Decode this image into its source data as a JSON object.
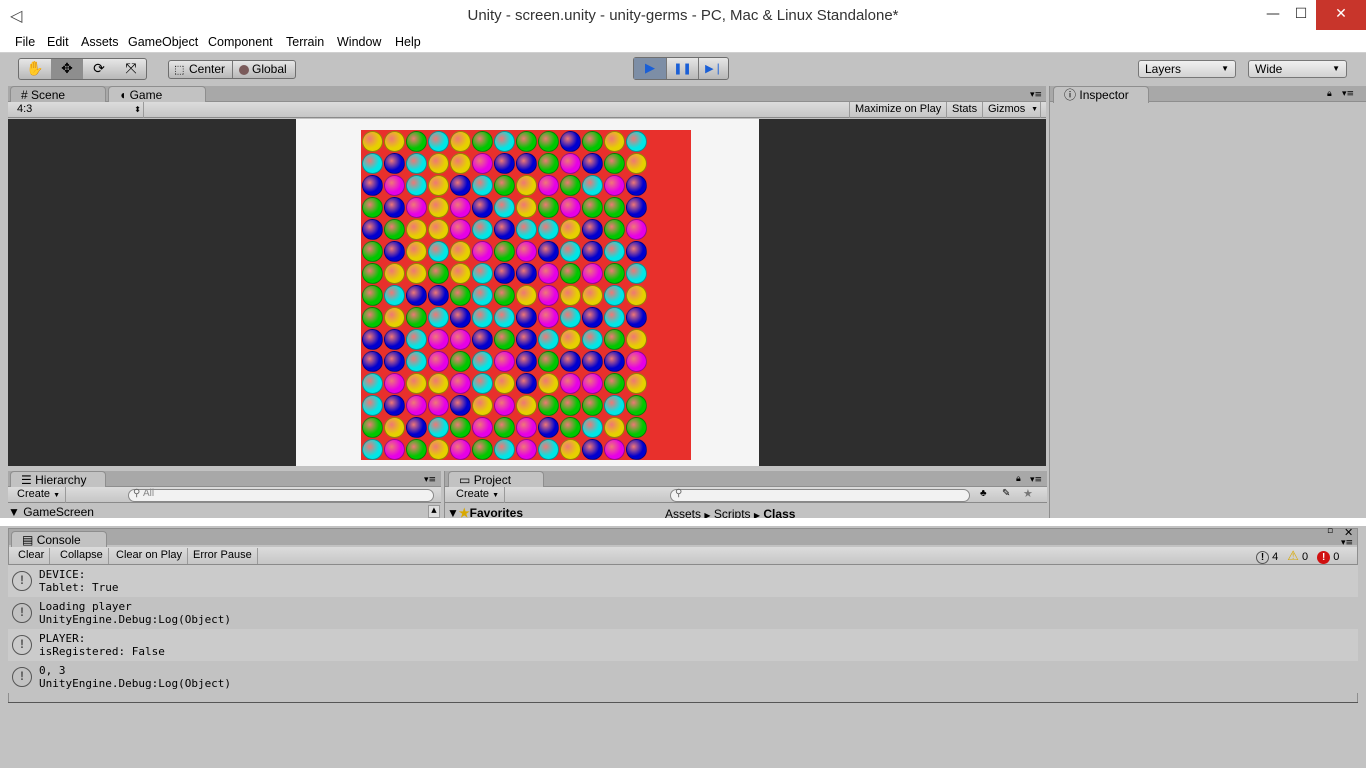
{
  "window": {
    "title": "Unity - screen.unity - unity-germs - PC, Mac & Linux Standalone*",
    "minimize": "—",
    "maximize": "☐",
    "close": "✕"
  },
  "menu": [
    "File",
    "Edit",
    "Assets",
    "GameObject",
    "Component",
    "Terrain",
    "Window",
    "Help"
  ],
  "toolbar": {
    "tools": [
      {
        "icon": "hand-icon",
        "glyph": "✋"
      },
      {
        "icon": "move-icon",
        "glyph": "✥"
      },
      {
        "icon": "rotate-icon",
        "glyph": "⟳"
      },
      {
        "icon": "scale-icon",
        "glyph": "⤧"
      }
    ],
    "pivot": "Center",
    "space": "Global",
    "play": "▶",
    "pause": "❚❚",
    "step": "▶❘",
    "layers": "Layers",
    "layout": "Wide"
  },
  "scene_tabs": {
    "scene": "Scene",
    "game": "Game"
  },
  "game_bar": {
    "aspect": "4:3",
    "maximize": "Maximize on Play",
    "stats": "Stats",
    "gizmos": "Gizmos"
  },
  "inspector": {
    "tab": "Inspector"
  },
  "hierarchy": {
    "tab": "Hierarchy",
    "create": "Create",
    "search_placeholder": "All",
    "root": "GameScreen"
  },
  "project": {
    "tab": "Project",
    "create": "Create",
    "favorites": "Favorites",
    "breadcrumb": [
      "Assets",
      "Scripts",
      "Class"
    ]
  },
  "console": {
    "tab": "Console",
    "buttons": [
      "Clear",
      "Collapse",
      "Clear on Play",
      "Error Pause"
    ],
    "counts": {
      "info": "4",
      "warn": "0",
      "error": "0"
    },
    "logs": [
      {
        "line1": "DEVICE:",
        "line2": "Tablet: True"
      },
      {
        "line1": "Loading player",
        "line2": "UnityEngine.Debug:Log(Object)"
      },
      {
        "line1": "PLAYER:",
        "line2": "isRegistered: False"
      },
      {
        "line1": "0, 3",
        "line2": "UnityEngine.Debug:Log(Object)"
      }
    ]
  },
  "colors": {
    "Y": "#e6d000",
    "C": "#00e6e6",
    "G": "#00c800",
    "B": "#0000d0",
    "M": "#e600e6",
    "board_bg": "#e8302c"
  },
  "board": [
    "YYGCYGCGGBGYC",
    "CBCYYMBBGMBGY",
    "BMCYBCGYMGCMB",
    "GBMYMBCYGMGGB",
    "BGYYMCBCCYBGM",
    "GBYCYMGMBCBCB",
    "GYYGYCBBMGMGC",
    "GCBBGCGYMYYCY",
    "GYGCBCCBMCBCB",
    "BBCMMBGBCYCGY",
    "BBCMGCMBGBBBM",
    "CMYYMCYBYMMGY",
    "CBMMBYMYGGGCG",
    "GYBCGMGMBGCYG",
    "CMGYMGCMCYBMB"
  ]
}
